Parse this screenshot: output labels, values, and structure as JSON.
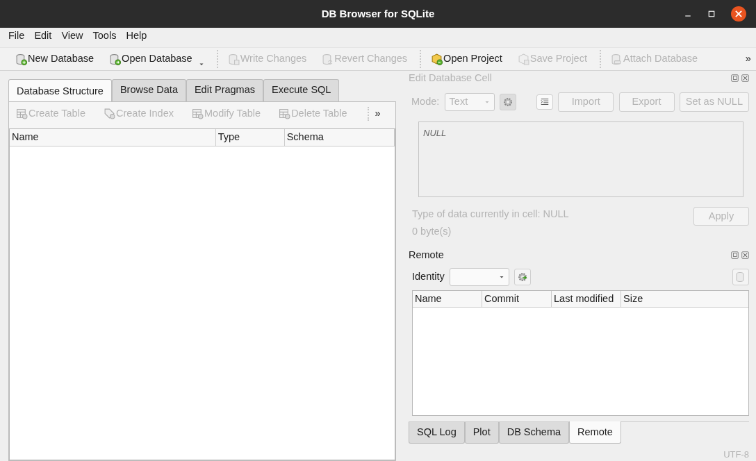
{
  "window": {
    "title": "DB Browser for SQLite"
  },
  "menu": [
    "File",
    "Edit",
    "View",
    "Tools",
    "Help"
  ],
  "toolbar": [
    {
      "label": "New Database",
      "disabled": false,
      "separator_before": false,
      "dropdown": false
    },
    {
      "label": "Open Database",
      "disabled": false,
      "separator_before": false,
      "dropdown": true
    },
    {
      "label": "Write Changes",
      "disabled": true,
      "separator_before": true,
      "dropdown": false
    },
    {
      "label": "Revert Changes",
      "disabled": true,
      "separator_before": false,
      "dropdown": false
    },
    {
      "label": "Open Project",
      "disabled": false,
      "separator_before": true,
      "dropdown": false
    },
    {
      "label": "Save Project",
      "disabled": true,
      "separator_before": false,
      "dropdown": false
    },
    {
      "label": "Attach Database",
      "disabled": true,
      "separator_before": true,
      "dropdown": false
    }
  ],
  "toolbar_overflow": "»",
  "left_tabs": [
    {
      "label": "Database Structure",
      "selected": true
    },
    {
      "label": "Browse Data",
      "selected": false
    },
    {
      "label": "Edit Pragmas",
      "selected": false
    },
    {
      "label": "Execute SQL",
      "selected": false
    }
  ],
  "structure_toolbar": [
    {
      "label": "Create Table",
      "disabled": true
    },
    {
      "label": "Create Index",
      "disabled": true
    },
    {
      "label": "Modify Table",
      "disabled": true
    },
    {
      "label": "Delete Table",
      "disabled": true
    }
  ],
  "structure_overflow": "»",
  "structure_table": {
    "columns": [
      "Name",
      "Type",
      "Schema"
    ]
  },
  "edit_cell": {
    "title": "Edit Database Cell",
    "disabled": true,
    "mode_label": "Mode:",
    "mode_value": "Text",
    "buttons": [
      {
        "label": "Import",
        "disabled": true
      },
      {
        "label": "Export",
        "disabled": true
      },
      {
        "label": "Set as NULL",
        "disabled": true
      }
    ],
    "cell_value": "NULL",
    "type_info": "Type of data currently in cell: NULL",
    "size_info": "0 byte(s)",
    "apply": {
      "label": "Apply",
      "disabled": true
    }
  },
  "remote": {
    "title": "Remote",
    "identity_label": "Identity",
    "columns": [
      "Name",
      "Commit",
      "Last modified",
      "Size"
    ]
  },
  "bottom_tabs": [
    {
      "label": "SQL Log",
      "selected": false
    },
    {
      "label": "Plot",
      "selected": false
    },
    {
      "label": "DB Schema",
      "selected": false
    },
    {
      "label": "Remote",
      "selected": true
    }
  ],
  "status_bar": "UTF-8"
}
